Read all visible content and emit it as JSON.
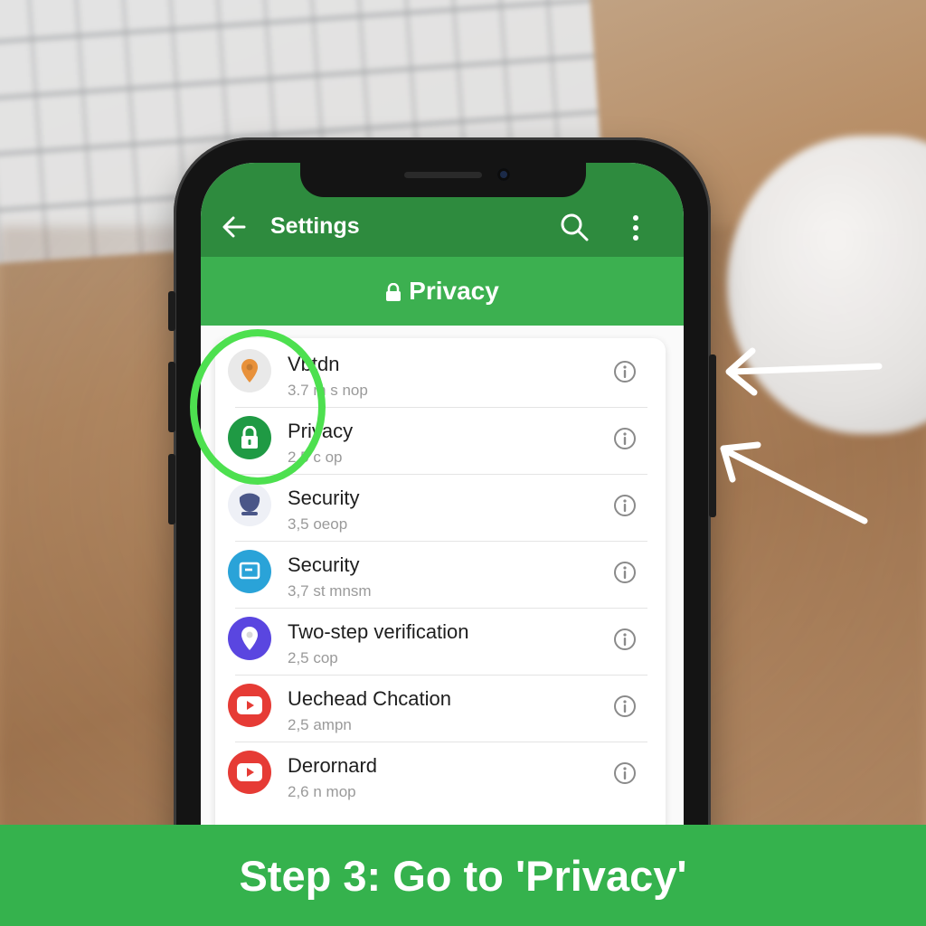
{
  "app_bar": {
    "title": "Settings"
  },
  "section": {
    "title": "Privacy"
  },
  "settings_list": [
    {
      "label": "Vbtdn",
      "sub": "3.7 m s nop",
      "icon": "location-pin-icon",
      "icon_bg": "#e9e9e9",
      "icon_color": "#e8913a"
    },
    {
      "label": "Privacy",
      "sub": "2,5 c op",
      "icon": "lock-icon",
      "icon_bg": "#1f9a44",
      "icon_color": "#ffffff"
    },
    {
      "label": "Security",
      "sub": "3,5 oeop",
      "icon": "shield-face-icon",
      "icon_bg": "#eef0f6",
      "icon_color": "#4a5688"
    },
    {
      "label": "Security",
      "sub": "3,7 st mnsm",
      "icon": "message-square-icon",
      "icon_bg": "#2aa3d8",
      "icon_color": "#ffffff"
    },
    {
      "label": "Two-step verification",
      "sub": "2,5 cop",
      "icon": "location-pin-icon",
      "icon_bg": "#5a46e0",
      "icon_color": "#ffffff"
    },
    {
      "label": "Uechead Chcation",
      "sub": "2,5 ampn",
      "icon": "play-icon",
      "icon_bg": "#e63b35",
      "icon_color": "#ffffff"
    },
    {
      "label": "Derornard",
      "sub": "2,6 n mop",
      "icon": "play-icon",
      "icon_bg": "#e63b35",
      "icon_color": "#ffffff"
    }
  ],
  "banner": {
    "text": "Step 3: Go to 'Privacy'"
  },
  "colors": {
    "appbar": "#2e8b3e",
    "section_header": "#3cb050",
    "highlight": "#4de04f",
    "banner": "#35b24d"
  }
}
